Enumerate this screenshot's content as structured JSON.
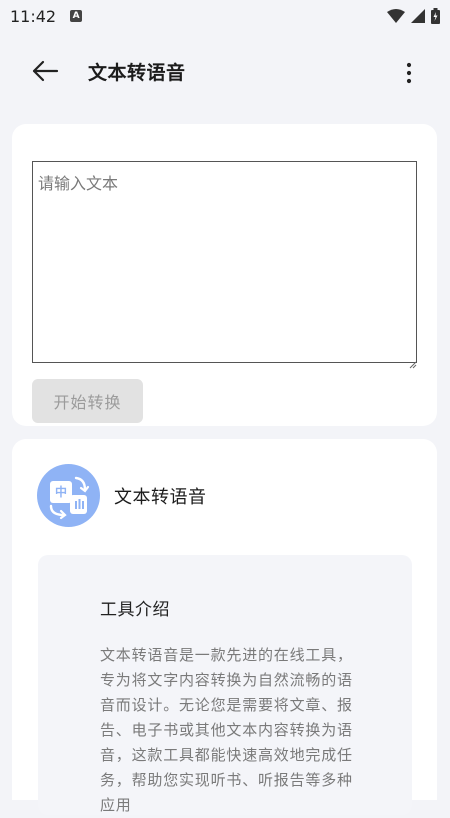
{
  "status_bar": {
    "time": "11:42",
    "notification_badge": "A"
  },
  "app_bar": {
    "title": "文本转语音"
  },
  "input_card": {
    "placeholder": "请输入文本",
    "start_button_label": "开始转换"
  },
  "tool_card": {
    "tool_name": "文本转语音",
    "intro_heading": "工具介绍",
    "intro_text": "文本转语音是一款先进的在线工具，专为将文字内容转换为自然流畅的语音而设计。无论您是需要将文章、报告、电子书或其他文本内容转换为语音，这款工具都能快速高效地完成任务，帮助您实现听书、听报告等多种应用"
  },
  "icons": {
    "back": "arrow-left-icon",
    "more": "more-vertical-icon",
    "tool": "text-to-speech-icon",
    "wifi": "wifi-icon",
    "signal": "signal-icon",
    "battery": "battery-icon"
  },
  "colors": {
    "background": "#f3f4f8",
    "card": "#ffffff",
    "icon_blue": "#8fb3f5",
    "button_disabled": "#e2e2e2"
  }
}
